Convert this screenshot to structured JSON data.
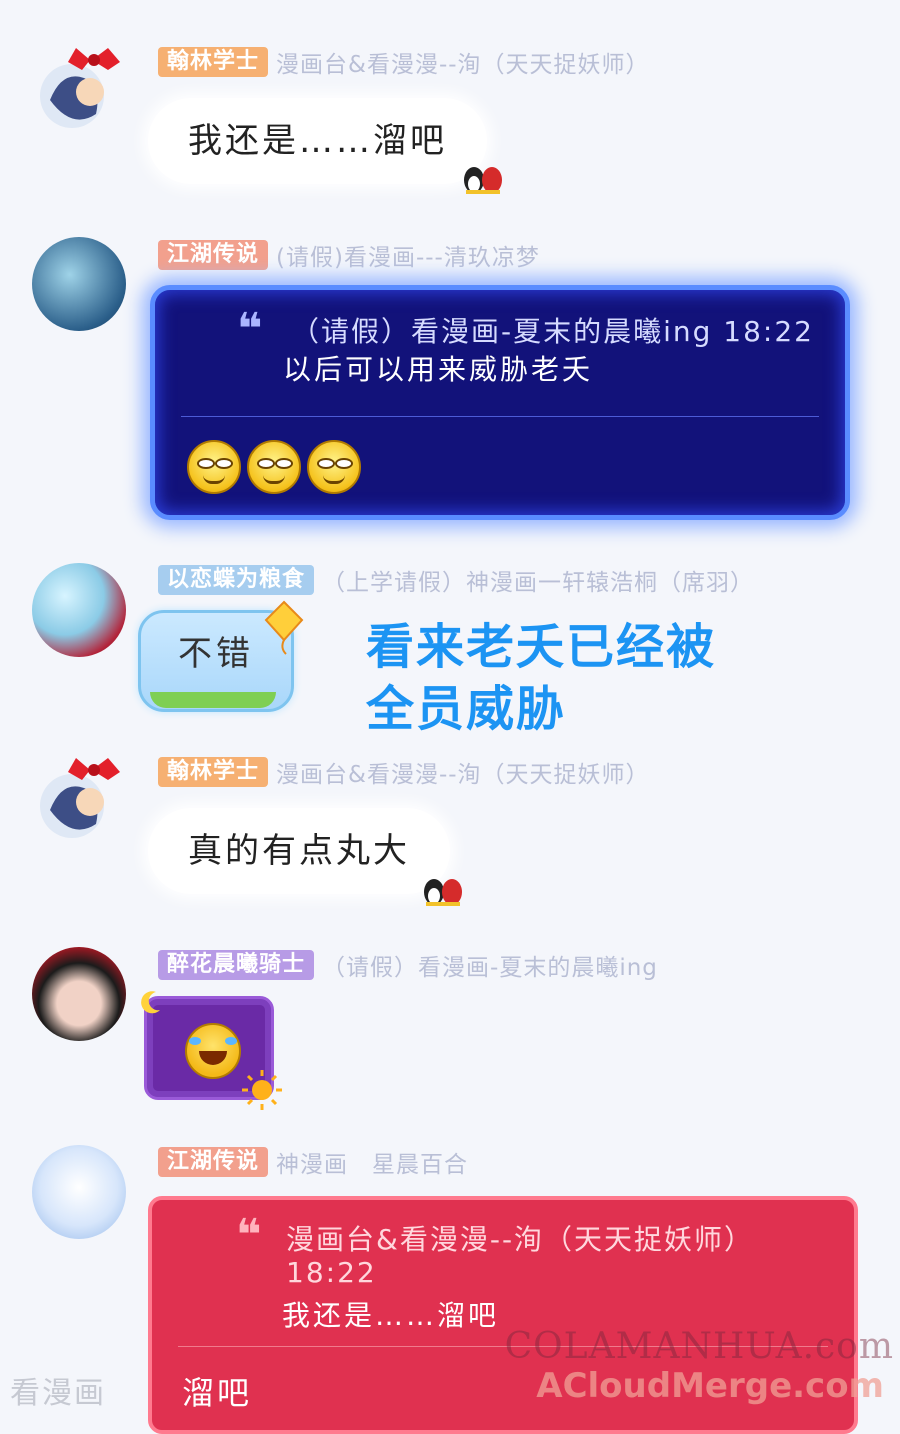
{
  "messages": [
    {
      "sender_tag": "翰林学士",
      "sender_title": "漫画台&看漫漫--洵（天天捉妖师）",
      "text": "我还是……溜吧"
    },
    {
      "sender_tag": "江湖传说",
      "sender_title": "(请假)看漫画---清玖凉梦",
      "quote_meta": "（请假）看漫画-夏末的晨曦ing 18:22",
      "quote_text": "以后可以用来威胁老夭"
    },
    {
      "sender_tag": "以恋蝶为粮食",
      "sender_title": "（上学请假）神漫画一轩辕浩桐（席羽）",
      "text": "不错"
    },
    {
      "sender_tag": "翰林学士",
      "sender_title": "漫画台&看漫漫--洵（天天捉妖师）",
      "text": "真的有点丸大"
    },
    {
      "sender_tag": "醉花晨曦骑士",
      "sender_title": "（请假）看漫画-夏末的晨曦ing"
    },
    {
      "sender_tag": "江湖传说",
      "sender_title": "神漫画　星晨百合",
      "quote_meta": "漫画台&看漫漫--洵（天天捉妖师）",
      "quote_time": "18:22",
      "quote_text": "我还是……溜吧",
      "reply": "溜吧"
    }
  ],
  "caption": {
    "line1": "看来老夭已经被",
    "line2": "全员威胁"
  },
  "watermarks": {
    "left": "看漫画",
    "right1": "COLAMANHUA.com",
    "right2": "ACloudMerge.com"
  },
  "colors": {
    "caption": "#1c94f3",
    "navy_bubble": "#12127a",
    "red_bubble": "#e03150"
  }
}
